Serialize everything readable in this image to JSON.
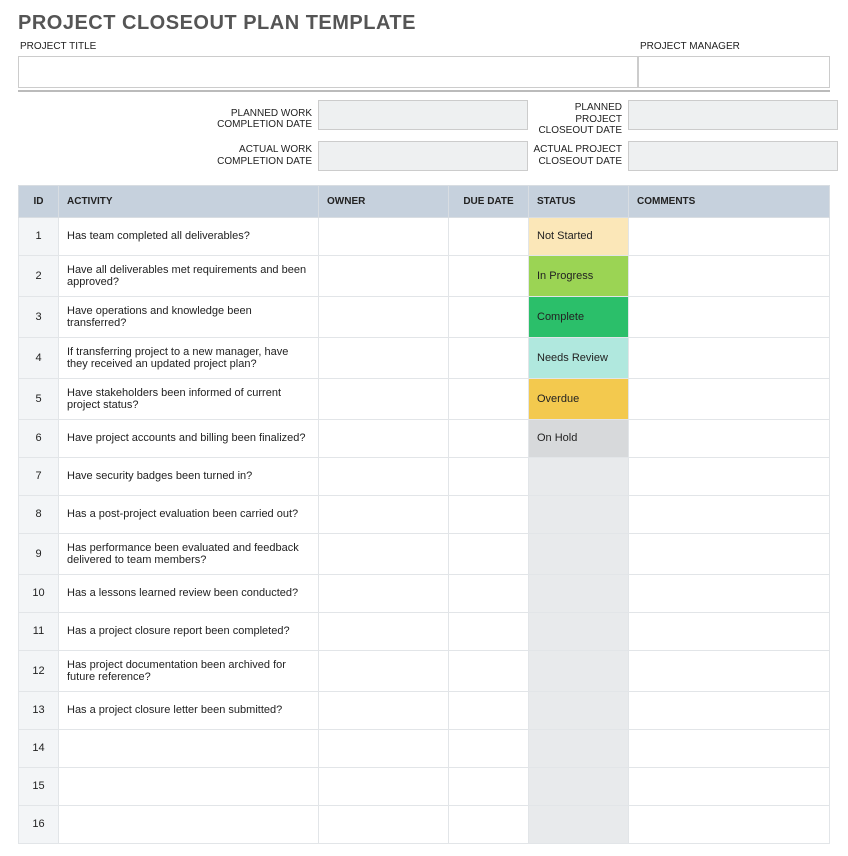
{
  "title": "PROJECT CLOSEOUT PLAN TEMPLATE",
  "header": {
    "project_title_label": "PROJECT TITLE",
    "project_title_value": "",
    "project_manager_label": "PROJECT MANAGER",
    "project_manager_value": ""
  },
  "dates": {
    "planned_work_label_l1": "PLANNED WORK",
    "planned_work_label_l2": "COMPLETION DATE",
    "planned_work_value": "",
    "planned_project_label_l1": "PLANNED PROJECT",
    "planned_project_label_l2": "CLOSEOUT DATE",
    "planned_project_value": "",
    "actual_work_label_l1": "ACTUAL WORK",
    "actual_work_label_l2": "COMPLETION DATE",
    "actual_work_value": "",
    "actual_project_label_l1": "ACTUAL PROJECT",
    "actual_project_label_l2": "CLOSEOUT DATE",
    "actual_project_value": ""
  },
  "columns": {
    "id": "ID",
    "activity": "ACTIVITY",
    "owner": "OWNER",
    "due": "DUE DATE",
    "status": "STATUS",
    "comments": "COMMENTS"
  },
  "status_colors": {
    "Not Started": "#fbe7b8",
    "In Progress": "#9bd454",
    "Complete": "#2bbf6a",
    "Needs Review": "#b0e8de",
    "Overdue": "#f3c94e",
    "On Hold": "#d7d9db"
  },
  "rows": [
    {
      "id": "1",
      "activity": "Has team completed all deliverables?",
      "owner": "",
      "due": "",
      "status": "Not Started",
      "comments": ""
    },
    {
      "id": "2",
      "activity": "Have all deliverables met requirements and been approved?",
      "owner": "",
      "due": "",
      "status": "In Progress",
      "comments": ""
    },
    {
      "id": "3",
      "activity": "Have operations and knowledge been transferred?",
      "owner": "",
      "due": "",
      "status": "Complete",
      "comments": ""
    },
    {
      "id": "4",
      "activity": "If transferring project to a new manager, have they received an updated project plan?",
      "owner": "",
      "due": "",
      "status": "Needs Review",
      "comments": ""
    },
    {
      "id": "5",
      "activity": "Have stakeholders been informed of current project status?",
      "owner": "",
      "due": "",
      "status": "Overdue",
      "comments": ""
    },
    {
      "id": "6",
      "activity": "Have project accounts and billing been finalized?",
      "owner": "",
      "due": "",
      "status": "On Hold",
      "comments": ""
    },
    {
      "id": "7",
      "activity": "Have security badges been turned in?",
      "owner": "",
      "due": "",
      "status": "",
      "comments": ""
    },
    {
      "id": "8",
      "activity": "Has a post-project evaluation been carried out?",
      "owner": "",
      "due": "",
      "status": "",
      "comments": ""
    },
    {
      "id": "9",
      "activity": "Has performance been evaluated and feedback delivered to team members?",
      "owner": "",
      "due": "",
      "status": "",
      "comments": ""
    },
    {
      "id": "10",
      "activity": "Has a lessons learned review been conducted?",
      "owner": "",
      "due": "",
      "status": "",
      "comments": ""
    },
    {
      "id": "11",
      "activity": "Has a project closure report been completed?",
      "owner": "",
      "due": "",
      "status": "",
      "comments": ""
    },
    {
      "id": "12",
      "activity": "Has project documentation been archived for future reference?",
      "owner": "",
      "due": "",
      "status": "",
      "comments": ""
    },
    {
      "id": "13",
      "activity": "Has a project closure letter been submitted?",
      "owner": "",
      "due": "",
      "status": "",
      "comments": ""
    },
    {
      "id": "14",
      "activity": "",
      "owner": "",
      "due": "",
      "status": "",
      "comments": ""
    },
    {
      "id": "15",
      "activity": "",
      "owner": "",
      "due": "",
      "status": "",
      "comments": ""
    },
    {
      "id": "16",
      "activity": "",
      "owner": "",
      "due": "",
      "status": "",
      "comments": ""
    }
  ]
}
